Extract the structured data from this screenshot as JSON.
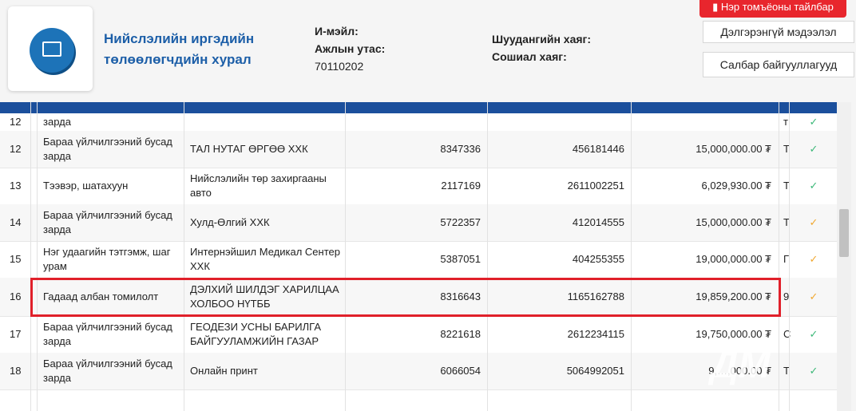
{
  "header": {
    "org_name": "Нийслэлийн иргэдийн төлөөлөгчдийн хурал",
    "email_label": "И-мэйл:",
    "phone_label": "Ажлын утас:",
    "phone_value": "70110202",
    "mailbox_label": "Шуудангийн хаяг:",
    "social_label": "Сошиал хаяг:",
    "glossary_button": "Нэр томъёоны тайлбар",
    "details_button": "Дэлгэрэнгүй мэдээлэл",
    "branches_button": "Салбар байгууллагууд"
  },
  "table": {
    "rows": [
      {
        "no": "12",
        "category": "зарда",
        "company": "",
        "reg": "",
        "account": "",
        "amount": "",
        "extra": "т",
        "status": "green"
      },
      {
        "no": "12",
        "category": "Бараа үйлчилгээний бусад зарда",
        "company": "ТАЛ НУТАГ ӨРГӨӨ ХХК",
        "reg": "8347336",
        "account": "456181446",
        "amount": "15,000,000.00 ₮",
        "extra": "Т",
        "status": "green"
      },
      {
        "no": "13",
        "category": "Тээвэр, шатахуун",
        "company": "Нийслэлийн төр захиргааны авто",
        "reg": "2117169",
        "account": "2611002251",
        "amount": "6,029,930.00 ₮",
        "extra": "Т",
        "status": "green"
      },
      {
        "no": "14",
        "category": "Бараа үйлчилгээний бусад зарда",
        "company": "Хулд-Өлгий ХХК",
        "reg": "5722357",
        "account": "412014555",
        "amount": "15,000,000.00 ₮",
        "extra": "Т",
        "status": "orange"
      },
      {
        "no": "15",
        "category": "Нэг удаагийн тэтгэмж, шаг урам",
        "company": "Интернэйшил Медикал Сентер ХХК",
        "reg": "5387051",
        "account": "404255355",
        "amount": "19,000,000.00 ₮",
        "extra": "Г",
        "status": "orange"
      },
      {
        "no": "16",
        "category": "Гадаад албан томилолт",
        "company": "ДЭЛХИЙ ШИЛДЭГ ХАРИЛЦАА ХОЛБОО НҮТББ",
        "reg": "8316643",
        "account": "1165162788",
        "amount": "19,859,200.00 ₮",
        "extra": "9",
        "status": "orange"
      },
      {
        "no": "17",
        "category": "Бараа үйлчилгээний бусад зарда",
        "company": "ГЕОДЕЗИ УСНЫ БАРИЛГА БАЙГУУЛАМЖИЙН ГАЗАР",
        "reg": "8221618",
        "account": "2612234115",
        "amount": "19,750,000.00 ₮",
        "extra": "С",
        "status": "green"
      },
      {
        "no": "18",
        "category": "Бараа үйлчилгээний бусад зарда",
        "company": "Онлайн принт",
        "reg": "6066054",
        "account": "5064992051",
        "amount": "9,…,000.00 ₮",
        "extra": "Т",
        "status": "green"
      }
    ]
  },
  "colors": {
    "green": "#3cb878",
    "orange": "#f0a830",
    "header_blue": "#1b4f9c",
    "highlight": "#e0202a"
  },
  "icons": {
    "check": "check-icon",
    "logo": "image-icon",
    "bookmark": "bookmark-icon"
  }
}
